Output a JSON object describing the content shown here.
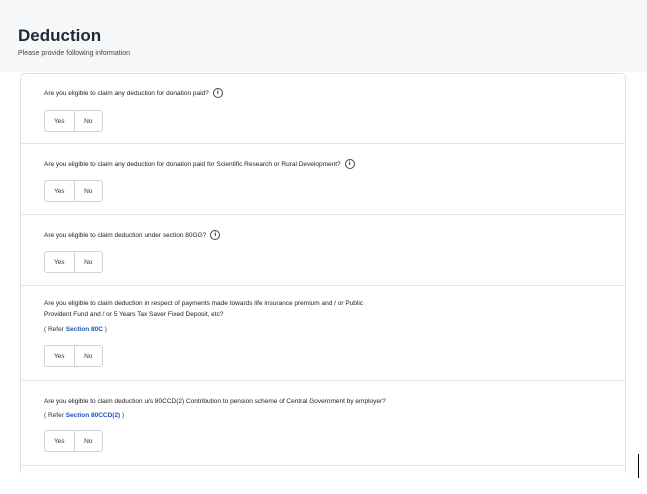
{
  "header": {
    "title": "Deduction",
    "subtitle": "Please provide following information"
  },
  "questions": [
    {
      "text": "Are you eligible to claim any deduction for donation paid?",
      "info_icon": "info-icon",
      "yes_label": "Yes",
      "no_label": "No"
    },
    {
      "text": "Are you eligible to claim any deduction for donation paid for Scientific Research or Rural Development?",
      "info_icon": "info-icon",
      "yes_label": "Yes",
      "no_label": "No"
    },
    {
      "text": "Are you eligible to claim deduction under section 80GG?",
      "info_icon": "info-icon",
      "yes_label": "Yes",
      "no_label": "No"
    },
    {
      "text_line1": "Are you eligible to claim deduction in respect of payments made towards life insurance premium and / or Public",
      "text_line2": "Provident Fund and / or 5 Years Tax Saver Fixed Deposit, etc?",
      "refer_prefix": "( Refer",
      "refer_link": "Section 80C",
      "refer_suffix": ")",
      "yes_label": "Yes",
      "no_label": "No"
    },
    {
      "text": "Are you eligible to claim deduction u/s 80CCD(2) Contribution to pension scheme of Central Government by employer?",
      "refer_prefix": "( Refer",
      "refer_link": "Section 80CCD(2)",
      "refer_suffix": ")",
      "yes_label": "Yes",
      "no_label": "No"
    }
  ],
  "info_glyph": "i"
}
